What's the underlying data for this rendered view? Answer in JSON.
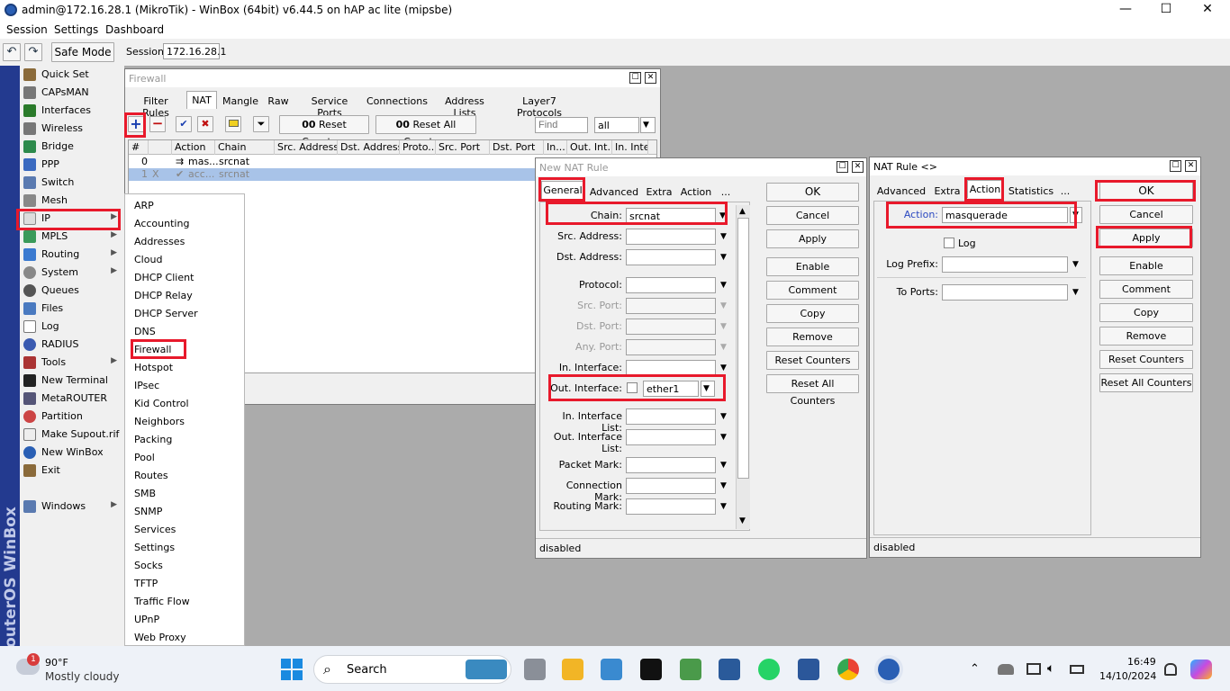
{
  "window": {
    "title": "admin@172.16.28.1 (MikroTik) - WinBox (64bit) v6.44.5 on hAP ac lite (mipsbe)",
    "minimize": "—",
    "maximize": "☐",
    "close": "✕"
  },
  "menu": {
    "session": "Session",
    "settings": "Settings",
    "dashboard": "Dashboard"
  },
  "toolbar": {
    "undo": "↶",
    "redo": "↷",
    "safe_mode": "Safe Mode",
    "session_label": "Session:",
    "session_value": "172.16.28.1"
  },
  "sidebar": {
    "brand": "RouterOS WinBox",
    "items": [
      {
        "label": "Quick Set"
      },
      {
        "label": "CAPsMAN"
      },
      {
        "label": "Interfaces"
      },
      {
        "label": "Wireless"
      },
      {
        "label": "Bridge"
      },
      {
        "label": "PPP"
      },
      {
        "label": "Switch"
      },
      {
        "label": "Mesh"
      },
      {
        "label": "IP"
      },
      {
        "label": "MPLS"
      },
      {
        "label": "Routing"
      },
      {
        "label": "System"
      },
      {
        "label": "Queues"
      },
      {
        "label": "Files"
      },
      {
        "label": "Log"
      },
      {
        "label": "RADIUS"
      },
      {
        "label": "Tools"
      },
      {
        "label": "New Terminal"
      },
      {
        "label": "MetaROUTER"
      },
      {
        "label": "Partition"
      },
      {
        "label": "Make Supout.rif"
      },
      {
        "label": "New WinBox"
      },
      {
        "label": "Exit"
      },
      {
        "label": "Windows"
      }
    ]
  },
  "ip_menu": {
    "items": [
      "ARP",
      "Accounting",
      "Addresses",
      "Cloud",
      "DHCP Client",
      "DHCP Relay",
      "DHCP Server",
      "DNS",
      "Firewall",
      "Hotspot",
      "IPsec",
      "Kid Control",
      "Neighbors",
      "Packing",
      "Pool",
      "Routes",
      "SMB",
      "SNMP",
      "Services",
      "Settings",
      "Socks",
      "TFTP",
      "Traffic Flow",
      "UPnP",
      "Web Proxy"
    ]
  },
  "firewall": {
    "title": "Firewall",
    "tabs": [
      "Filter Rules",
      "NAT",
      "Mangle",
      "Raw",
      "Service Ports",
      "Connections",
      "Address Lists",
      "Layer7 Protocols"
    ],
    "reset_counters": "Reset Counters",
    "reset_all_counters": "Reset All Counters",
    "counter_prefix": "00",
    "find_placeholder": "Find",
    "filter_value": "all",
    "columns": [
      "#",
      "",
      "Action",
      "Chain",
      "Src. Address",
      "Dst. Address",
      "Proto...",
      "Src. Port",
      "Dst. Port",
      "In....",
      "Out. Int...",
      "In. Inte"
    ],
    "rows": [
      {
        "num": "0",
        "flag": "",
        "action": "mas...",
        "chain": "srcnat"
      },
      {
        "num": "1",
        "flag": "X",
        "action": "acc...",
        "chain": "srcnat"
      }
    ]
  },
  "new_nat": {
    "title": "New NAT Rule",
    "tabs": [
      "General",
      "Advanced",
      "Extra",
      "Action",
      "..."
    ],
    "fields": {
      "chain": {
        "label": "Chain:",
        "value": "srcnat"
      },
      "src_address": {
        "label": "Src. Address:",
        "value": ""
      },
      "dst_address": {
        "label": "Dst. Address:",
        "value": ""
      },
      "protocol": {
        "label": "Protocol:",
        "value": ""
      },
      "src_port": {
        "label": "Src. Port:",
        "value": ""
      },
      "dst_port": {
        "label": "Dst. Port:",
        "value": ""
      },
      "any_port": {
        "label": "Any. Port:",
        "value": ""
      },
      "in_interface": {
        "label": "In. Interface:",
        "value": ""
      },
      "out_interface": {
        "label": "Out. Interface:",
        "value": "ether1"
      },
      "in_interface_list": {
        "label": "In. Interface List:",
        "value": ""
      },
      "out_interface_list": {
        "label": "Out. Interface List:",
        "value": ""
      },
      "packet_mark": {
        "label": "Packet Mark:",
        "value": ""
      },
      "connection_mark": {
        "label": "Connection Mark:",
        "value": ""
      },
      "routing_mark": {
        "label": "Routing Mark:",
        "value": ""
      }
    },
    "buttons": [
      "OK",
      "Cancel",
      "Apply",
      "Enable",
      "Comment",
      "Copy",
      "Remove",
      "Reset Counters",
      "Reset All Counters"
    ],
    "status": "disabled"
  },
  "nat_rule": {
    "title": "NAT Rule <>",
    "tabs": [
      "Advanced",
      "Extra",
      "Action",
      "Statistics",
      "..."
    ],
    "action": {
      "label": "Action:",
      "value": "masquerade"
    },
    "log_label": "Log",
    "log_prefix": {
      "label": "Log Prefix:",
      "value": ""
    },
    "to_ports": {
      "label": "To Ports:",
      "value": ""
    },
    "buttons": [
      "OK",
      "Cancel",
      "Apply",
      "Enable",
      "Comment",
      "Copy",
      "Remove",
      "Reset Counters",
      "Reset All Counters"
    ],
    "status": "disabled"
  },
  "taskbar": {
    "weather_temp": "90°F",
    "weather_desc": "Mostly cloudy",
    "weather_badge": "1",
    "search_label": "Search",
    "time": "16:49",
    "date": "14/10/2024"
  }
}
